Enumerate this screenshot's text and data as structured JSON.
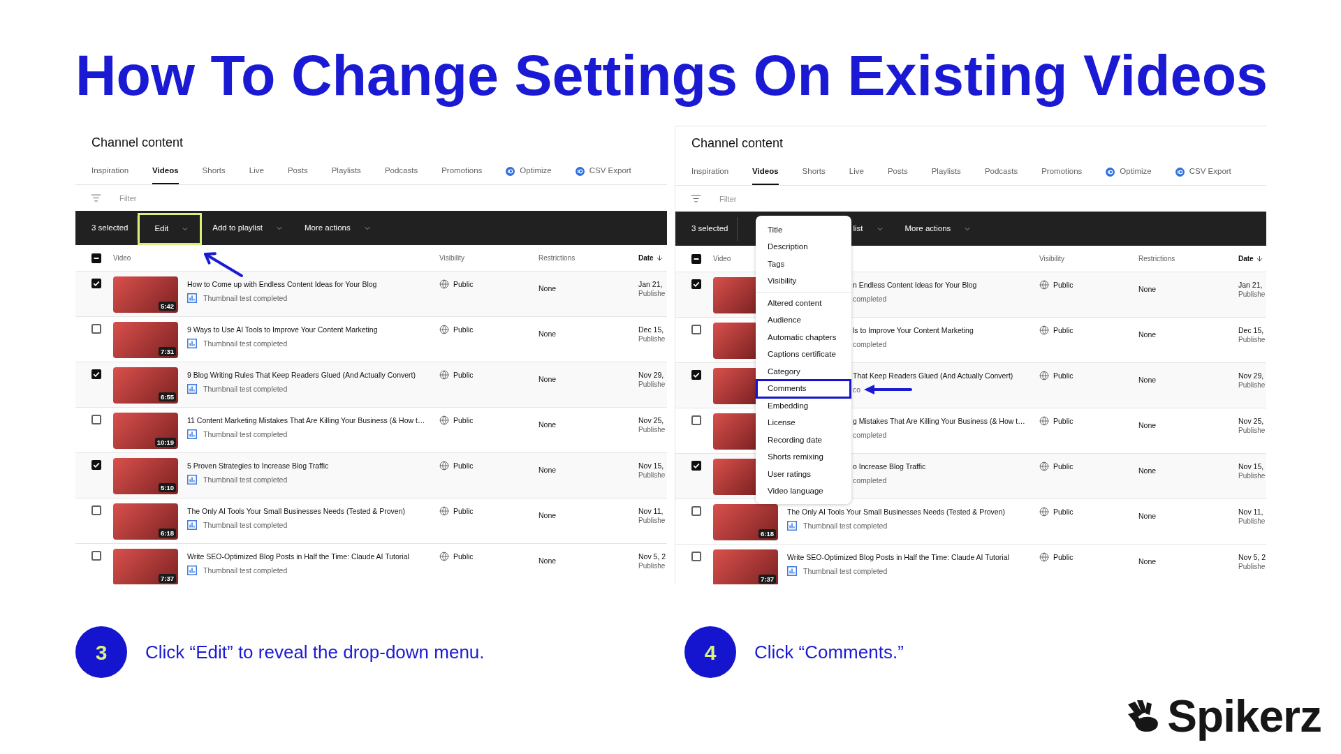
{
  "title": "How To Change Settings On Existing Videos",
  "panels": [
    {
      "framed": false,
      "heading": "Channel content",
      "tabs": [
        {
          "label": "Inspiration",
          "kind": "plain",
          "selected": false
        },
        {
          "label": "Videos",
          "kind": "plain",
          "selected": true
        },
        {
          "label": "Shorts",
          "kind": "plain",
          "selected": false
        },
        {
          "label": "Live",
          "kind": "plain",
          "selected": false
        },
        {
          "label": "Posts",
          "kind": "plain",
          "selected": false
        },
        {
          "label": "Playlists",
          "kind": "plain",
          "selected": false
        },
        {
          "label": "Podcasts",
          "kind": "plain",
          "selected": false
        },
        {
          "label": "Promotions",
          "kind": "plain",
          "selected": false
        },
        {
          "label": "Optimize",
          "kind": "extension",
          "selected": false
        },
        {
          "label": "CSV Export",
          "kind": "extension",
          "selected": false
        }
      ],
      "filter": {
        "placeholder": "Filter"
      },
      "toolbar": {
        "selection": "3 selected",
        "actions": [
          {
            "label": "Edit",
            "highlighted": true,
            "covered": false
          },
          {
            "label": "Add to playlist",
            "highlighted": false,
            "covered": false
          },
          {
            "label": "More actions",
            "highlighted": false,
            "covered": false
          }
        ]
      },
      "select_all": {
        "indeterminate": true
      },
      "columns": [
        {
          "label": "Video",
          "kind": "plain"
        },
        {
          "label": "Visibility",
          "kind": "plain"
        },
        {
          "label": "Restrictions",
          "kind": "plain"
        },
        {
          "label": "Date",
          "kind": "sorted"
        }
      ],
      "rows": [
        {
          "checked": true,
          "covered": false,
          "duration": "5:42",
          "title": "How to Come up with Endless Content Ideas for Your Blog",
          "status": "Thumbnail test completed",
          "visibility": "Public",
          "restrictions": "None",
          "date": "Jan 21,",
          "date_status": "Publishe"
        },
        {
          "checked": false,
          "covered": false,
          "duration": "7:31",
          "title": "9 Ways to Use AI Tools to Improve Your Content Marketing",
          "status": "Thumbnail test completed",
          "visibility": "Public",
          "restrictions": "None",
          "date": "Dec 15,",
          "date_status": "Publishe"
        },
        {
          "checked": true,
          "covered": false,
          "duration": "6:55",
          "title": "9 Blog Writing Rules That Keep Readers Glued (And Actually Convert)",
          "status": "Thumbnail test completed",
          "visibility": "Public",
          "restrictions": "None",
          "date": "Nov 29,",
          "date_status": "Publishe"
        },
        {
          "checked": false,
          "covered": false,
          "duration": "10:19",
          "title": "11 Content Marketing Mistakes That Are Killing Your Business (& How t…",
          "status": "Thumbnail test completed",
          "visibility": "Public",
          "restrictions": "None",
          "date": "Nov 25,",
          "date_status": "Publishe"
        },
        {
          "checked": true,
          "covered": false,
          "duration": "5:10",
          "title": "5 Proven Strategies to Increase Blog Traffic",
          "status": "Thumbnail test completed",
          "visibility": "Public",
          "restrictions": "None",
          "date": "Nov 15,",
          "date_status": "Publishe"
        },
        {
          "checked": false,
          "covered": false,
          "duration": "6:18",
          "title": "The Only AI Tools Your Small Businesses Needs (Tested & Proven)",
          "status": "Thumbnail test completed",
          "visibility": "Public",
          "restrictions": "None",
          "date": "Nov 11,",
          "date_status": "Publishe"
        },
        {
          "checked": false,
          "covered": false,
          "duration": "7:37",
          "title": "Write SEO-Optimized Blog Posts in Half the Time: Claude AI Tutorial",
          "status": "Thumbnail test completed",
          "visibility": "Public",
          "restrictions": "None",
          "date": "Nov 5, 2",
          "date_status": "Publishe"
        }
      ],
      "arrow": {
        "kind": "diagonal"
      }
    },
    {
      "framed": true,
      "heading": "Channel content",
      "tabs": [
        {
          "label": "Inspiration",
          "kind": "plain",
          "selected": false
        },
        {
          "label": "Videos",
          "kind": "plain",
          "selected": true
        },
        {
          "label": "Shorts",
          "kind": "plain",
          "selected": false
        },
        {
          "label": "Live",
          "kind": "plain",
          "selected": false
        },
        {
          "label": "Posts",
          "kind": "plain",
          "selected": false
        },
        {
          "label": "Playlists",
          "kind": "plain",
          "selected": false
        },
        {
          "label": "Podcasts",
          "kind": "plain",
          "selected": false
        },
        {
          "label": "Promotions",
          "kind": "plain",
          "selected": false
        },
        {
          "label": "Optimize",
          "kind": "extension",
          "selected": false
        },
        {
          "label": "CSV Export",
          "kind": "extension",
          "selected": false
        }
      ],
      "filter": {
        "placeholder": "Filter"
      },
      "toolbar": {
        "selection": "3 selected",
        "actions": [
          {
            "label": "list",
            "highlighted": false,
            "covered": true
          },
          {
            "label": "More actions",
            "highlighted": false,
            "covered": false
          }
        ]
      },
      "select_all": {
        "indeterminate": true
      },
      "columns": [
        {
          "label": "Video",
          "kind": "plain"
        },
        {
          "label": "Visibility",
          "kind": "plain"
        },
        {
          "label": "Restrictions",
          "kind": "plain"
        },
        {
          "label": "Date",
          "kind": "sorted"
        }
      ],
      "rows": [
        {
          "checked": true,
          "covered": true,
          "title": "n Endless Content Ideas for Your Blog",
          "status": "completed",
          "visibility": "Public",
          "restrictions": "None",
          "date": "Jan 21,",
          "date_status": "Publishe"
        },
        {
          "checked": false,
          "covered": true,
          "title": "ls to Improve Your Content Marketing",
          "status": "completed",
          "visibility": "Public",
          "restrictions": "None",
          "date": "Dec 15,",
          "date_status": "Publishe"
        },
        {
          "checked": true,
          "covered": true,
          "title": "That Keep Readers Glued (And Actually Convert)",
          "status": "co",
          "visibility": "Public",
          "restrictions": "None",
          "date": "Nov 29,",
          "date_status": "Publishe"
        },
        {
          "checked": false,
          "covered": true,
          "title": "g Mistakes That Are Killing Your Business (& How t…",
          "status": "completed",
          "visibility": "Public",
          "restrictions": "None",
          "date": "Nov 25,",
          "date_status": "Publishe"
        },
        {
          "checked": true,
          "covered": true,
          "title": "o Increase Blog Traffic",
          "status": "completed",
          "visibility": "Public",
          "restrictions": "None",
          "date": "Nov 15,",
          "date_status": "Publishe"
        },
        {
          "checked": false,
          "covered": false,
          "duration": "6:18",
          "title": "The Only AI Tools Your Small Businesses Needs (Tested & Proven)",
          "status": "Thumbnail test completed",
          "visibility": "Public",
          "restrictions": "None",
          "date": "Nov 11,",
          "date_status": "Publishe"
        },
        {
          "checked": false,
          "covered": false,
          "duration": "7:37",
          "title": "Write SEO-Optimized Blog Posts in Half the Time: Claude AI Tutorial",
          "status": "Thumbnail test completed",
          "visibility": "Public",
          "restrictions": "None",
          "date": "Nov 5, 2",
          "date_status": "Publishe"
        }
      ],
      "menu": {
        "groups": [
          {
            "items": [
              {
                "label": "Title",
                "highlighted": false
              },
              {
                "label": "Description",
                "highlighted": false
              },
              {
                "label": "Tags",
                "highlighted": false
              },
              {
                "label": "Visibility",
                "highlighted": false
              }
            ]
          },
          {
            "items": [
              {
                "label": "Altered content",
                "highlighted": false
              },
              {
                "label": "Audience",
                "highlighted": false
              },
              {
                "label": "Automatic chapters",
                "highlighted": false
              },
              {
                "label": "Captions certificate",
                "highlighted": false
              },
              {
                "label": "Category",
                "highlighted": false
              },
              {
                "label": "Comments",
                "highlighted": true
              },
              {
                "label": "Embedding",
                "highlighted": false
              },
              {
                "label": "License",
                "highlighted": false
              },
              {
                "label": "Recording date",
                "highlighted": false
              },
              {
                "label": "Shorts remixing",
                "highlighted": false
              },
              {
                "label": "User ratings",
                "highlighted": false
              },
              {
                "label": "Video language",
                "highlighted": false
              }
            ]
          }
        ]
      },
      "arrow": {
        "kind": "horizontal"
      }
    }
  ],
  "steps": [
    {
      "number": "3",
      "text": "Click “Edit” to reveal the drop-down menu."
    },
    {
      "number": "4",
      "text": "Click “Comments.”"
    }
  ],
  "logo": {
    "text": "Spikerz"
  }
}
